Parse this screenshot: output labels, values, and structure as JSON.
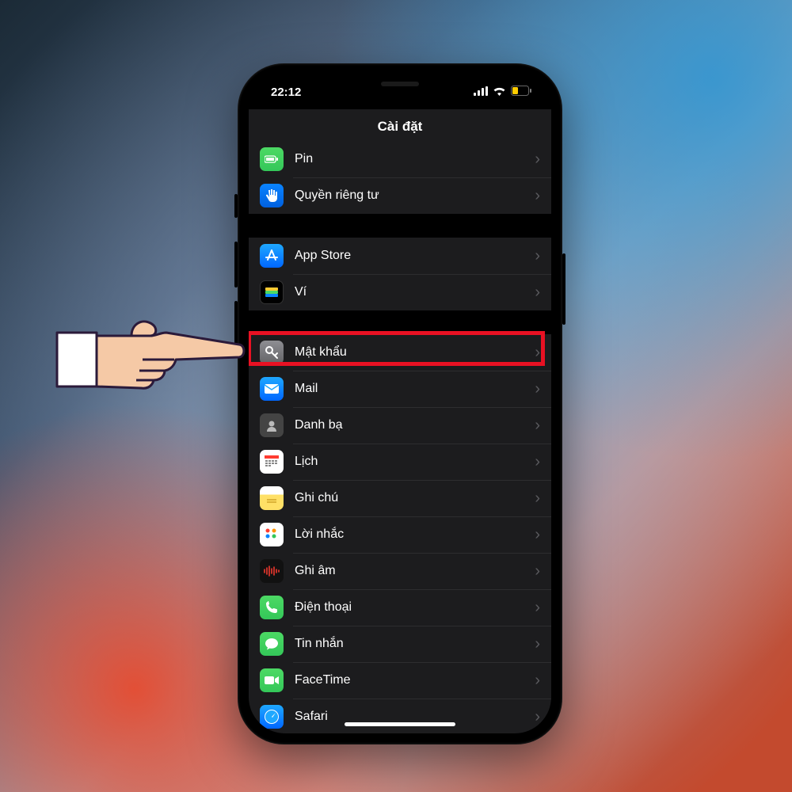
{
  "status": {
    "time": "22:12"
  },
  "header": {
    "title": "Cài đặt"
  },
  "groups": [
    {
      "items": [
        {
          "key": "battery",
          "label": "Pin"
        },
        {
          "key": "privacy",
          "label": "Quyền riêng tư"
        }
      ]
    },
    {
      "items": [
        {
          "key": "appstore",
          "label": "App Store"
        },
        {
          "key": "wallet",
          "label": "Ví"
        }
      ]
    },
    {
      "items": [
        {
          "key": "passwords",
          "label": "Mật khẩu",
          "highlighted": true
        },
        {
          "key": "mail",
          "label": "Mail"
        },
        {
          "key": "contacts",
          "label": "Danh bạ"
        },
        {
          "key": "calendar",
          "label": "Lịch"
        },
        {
          "key": "notes",
          "label": "Ghi chú"
        },
        {
          "key": "reminders",
          "label": "Lời nhắc"
        },
        {
          "key": "voice",
          "label": "Ghi âm"
        },
        {
          "key": "phone",
          "label": "Điện thoại"
        },
        {
          "key": "messages",
          "label": "Tin nhắn"
        },
        {
          "key": "facetime",
          "label": "FaceTime"
        },
        {
          "key": "safari",
          "label": "Safari"
        }
      ]
    }
  ],
  "highlight_color": "#e81123"
}
